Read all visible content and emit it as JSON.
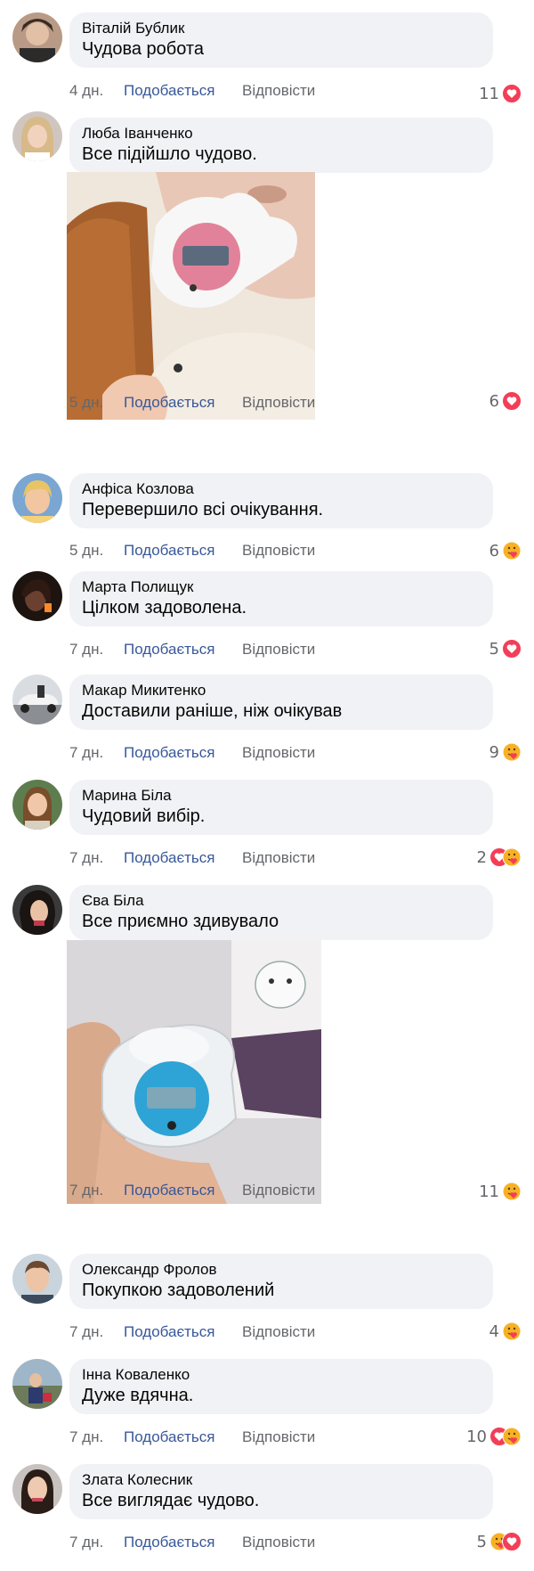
{
  "actions": {
    "like_label": "Подобається",
    "reply_label": "Відповісти"
  },
  "colors": {
    "bubble": "#f0f2f5",
    "link": "#385898",
    "meta": "#65676b",
    "heart": "#f33e58",
    "care": "#f7b125"
  },
  "comments": [
    {
      "name": "Віталій Бублик",
      "text": "Чудова робота",
      "time": "4 дн.",
      "count": "11",
      "reactions": [
        "heart-icon"
      ]
    },
    {
      "name": "Люба Іванченко",
      "text": "Все підійшло чудово.",
      "time": "5 дн.",
      "count": "6",
      "reactions": [
        "heart-icon"
      ],
      "photo": "pink pacifier thermometer"
    },
    {
      "name": "Анфіса Козлова",
      "text": "Перевершило всі очікування.",
      "time": "5 дн.",
      "count": "6",
      "reactions": [
        "care-icon"
      ]
    },
    {
      "name": "Марта Полищук",
      "text": "Цілком задоволена.",
      "time": "7 дн.",
      "count": "5",
      "reactions": [
        "heart-icon"
      ]
    },
    {
      "name": "Макар Микитенко",
      "text": "Доставили раніше, ніж очікував",
      "time": "7 дн.",
      "count": "9",
      "reactions": [
        "care-icon"
      ]
    },
    {
      "name": "Марина Біла",
      "text": "Чудовий вибір.",
      "time": "7 дн.",
      "count": "2",
      "reactions": [
        "heart-icon",
        "care-icon"
      ]
    },
    {
      "name": "Єва Біла",
      "text": "Все приємно здивувало",
      "time": "7 дн.",
      "count": "11",
      "reactions": [
        "care-icon"
      ],
      "photo": "blue pacifier thermometer"
    },
    {
      "name": "Олександр Фролов",
      "text": "Покупкою задоволений",
      "time": "7 дн.",
      "count": "4",
      "reactions": [
        "care-icon"
      ]
    },
    {
      "name": "Інна Коваленко",
      "text": "Дуже вдячна.",
      "time": "7 дн.",
      "count": "10",
      "reactions": [
        "heart-icon",
        "care-icon"
      ]
    },
    {
      "name": "Злата Колесник",
      "text": "Все виглядає чудово.",
      "time": "7 дн.",
      "count": "5",
      "reactions": [
        "care-icon",
        "heart-icon"
      ]
    }
  ]
}
